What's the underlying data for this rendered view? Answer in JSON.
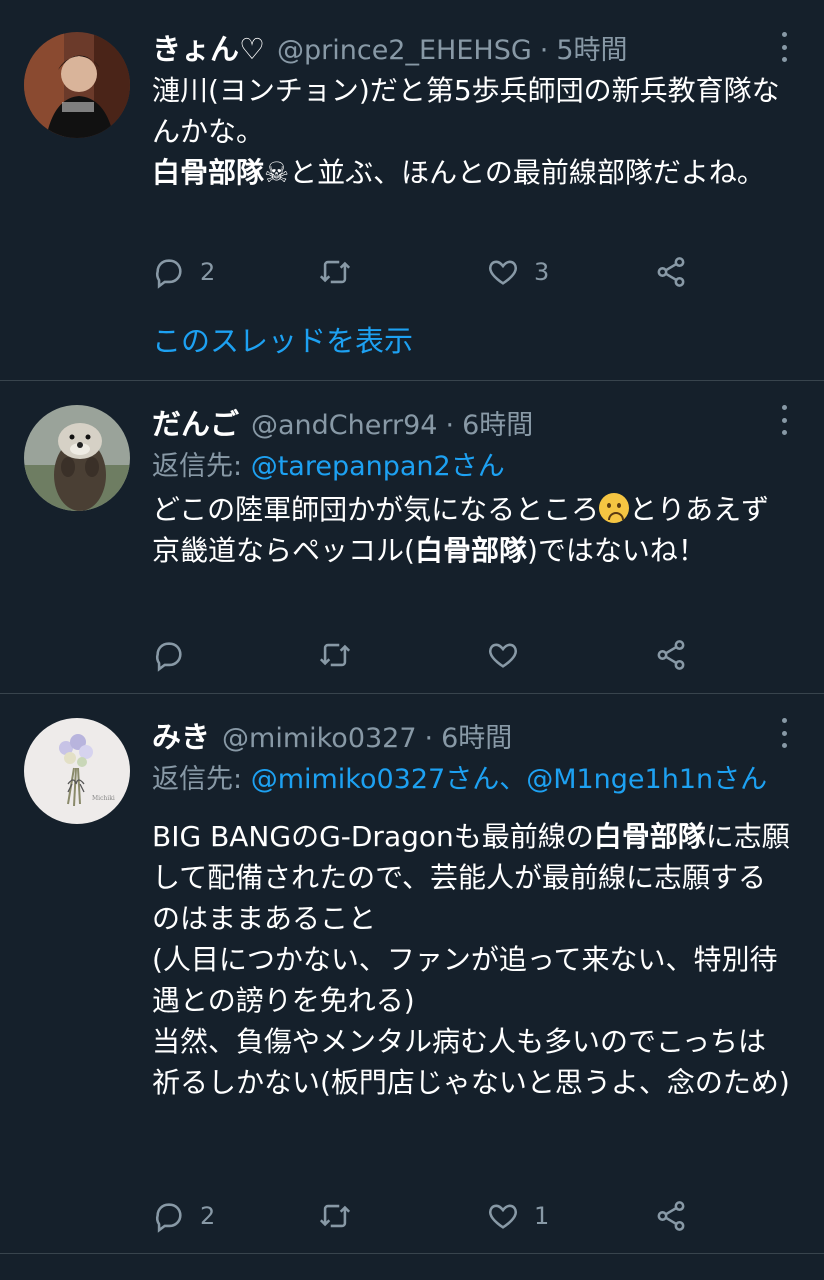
{
  "tweets": [
    {
      "name": "きょん♡",
      "handle": "@prince2_EHEHSG",
      "time": "5時間",
      "body_a": "漣川(ヨンチョン)だと第5歩兵師団の新兵教育隊なんかな。\n",
      "body_bold": "白骨部隊",
      "body_b": "☠と並ぶ、ほんとの最前線部隊だよね。",
      "replies": "2",
      "retweets": "",
      "likes": "3",
      "thread_link": "このスレッドを表示"
    },
    {
      "name": "だんご",
      "handle": "@andCherr94",
      "time": "6時間",
      "reply_label": "返信先: ",
      "reply_to": "@tarepanpan2さん",
      "body_a": "どこの陸軍師団かが気になるところ",
      "body_b": "とりあえず京畿道ならペッコル(",
      "body_bold": "白骨部隊",
      "body_c": ")ではないね！",
      "replies": "",
      "retweets": "",
      "likes": ""
    },
    {
      "name": "みき",
      "handle": "@mimiko0327",
      "time": "6時間",
      "reply_label": "返信先: ",
      "reply_to": "@mimiko0327さん、@M1nge1h1nさん",
      "body_a": "BIG BANGのG-Dragonも最前線の",
      "body_bold": "白骨部隊",
      "body_b": "に志願して配備されたので、芸能人が最前線に志願するのはままあること\n(人目につかない、ファンが追って来ない、特別待遇との謗りを免れる)\n当然、負傷やメンタル病む人も多いのでこっちは祈るしかない(板門店じゃないと思うよ、念のため)",
      "replies": "2",
      "retweets": "",
      "likes": "1"
    }
  ],
  "colors": {
    "background": "#15202b",
    "secondary_text": "#8899a6",
    "link": "#1da1f2",
    "divider": "#38444d"
  },
  "icons": [
    "more-icon",
    "reply-icon",
    "retweet-icon",
    "like-icon",
    "share-icon",
    "skull-icon",
    "worried-face-emoji"
  ]
}
